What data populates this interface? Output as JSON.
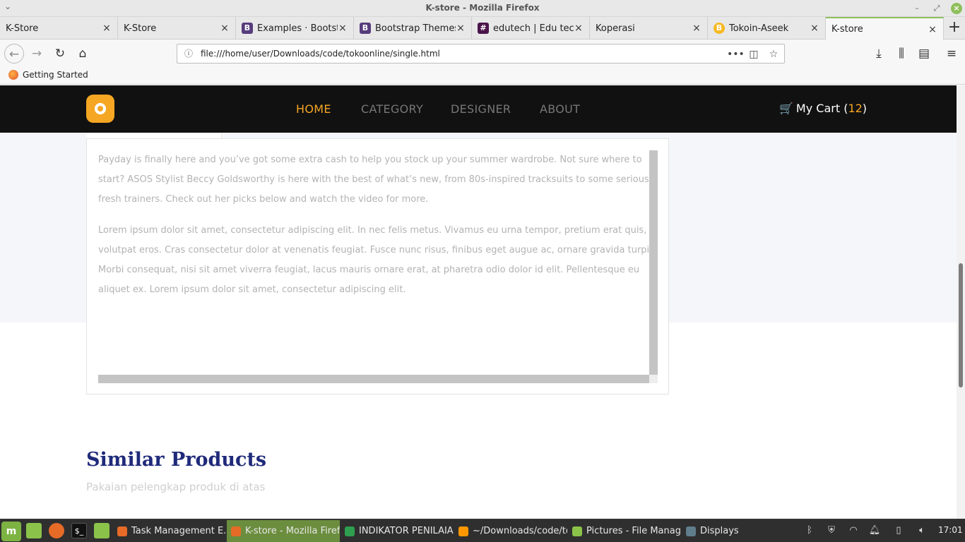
{
  "window": {
    "title": "K-store - Mozilla Firefox"
  },
  "tabs": [
    {
      "label": "K-Store",
      "icon": "none",
      "color": ""
    },
    {
      "label": "K-Store",
      "icon": "none",
      "color": ""
    },
    {
      "label": "Examples · Bootstr",
      "icon": "B",
      "color": "#563d7c"
    },
    {
      "label": "Bootstrap Themes",
      "icon": "B",
      "color": "#563d7c"
    },
    {
      "label": "edutech | Edu tech",
      "icon": "slack",
      "color": "#4a154b"
    },
    {
      "label": "Koperasi",
      "icon": "none",
      "color": ""
    },
    {
      "label": "Tokoin-Aseek",
      "icon": "B",
      "color": "#f7b924"
    },
    {
      "label": "K-store",
      "icon": "none",
      "color": ""
    }
  ],
  "toolbar": {
    "url": "file:///home/user/Downloads/code/tokoonline/single.html"
  },
  "bookmarks": {
    "getting_started": "Getting Started"
  },
  "site": {
    "nav": {
      "home": "HOME",
      "category": "CATEGORY",
      "designer": "DESIGNER",
      "about": "ABOUT"
    },
    "cart_label": "My Cart (",
    "cart_count": "12",
    "cart_close": ")",
    "accent": "#f5a623",
    "description": {
      "p1": "Payday is finally here and you’ve got some extra cash to help you stock up your summer wardrobe. Not sure where to start? ASOS Stylist Beccy Goldsworthy is here with the best of what’s new, from 80s-inspired tracksuits to some seriously fresh trainers. Check out her picks below and watch the video for more.",
      "p2": "Lorem ipsum dolor sit amet, consectetur adipiscing elit. In nec felis metus. Vivamus eu urna tempor, pretium erat quis, volutpat eros. Cras consectetur dolor at venenatis feugiat. Fusce nunc risus, finibus eget augue ac, ornare gravida turpis. Morbi consequat, nisi sit amet viverra feugiat, lacus mauris ornare erat, at pharetra odio dolor id elit. Pellentesque eu aliquet ex. Lorem ipsum dolor sit amet, consectetur adipiscing elit."
    },
    "similar": {
      "title": "Similar Products",
      "subtitle": "Pakaian pelengkap produk di atas"
    }
  },
  "taskbar": {
    "windows": [
      {
        "label": "Task Management E...",
        "active": false
      },
      {
        "label": "K-store - Mozilla Firef...",
        "active": true
      },
      {
        "label": "INDIKATOR PENILAIA...",
        "active": false
      },
      {
        "label": "~/Downloads/code/to...",
        "active": false
      },
      {
        "label": "Pictures - File Manager",
        "active": false
      },
      {
        "label": "Displays",
        "active": false
      }
    ],
    "clock": "17:01"
  }
}
